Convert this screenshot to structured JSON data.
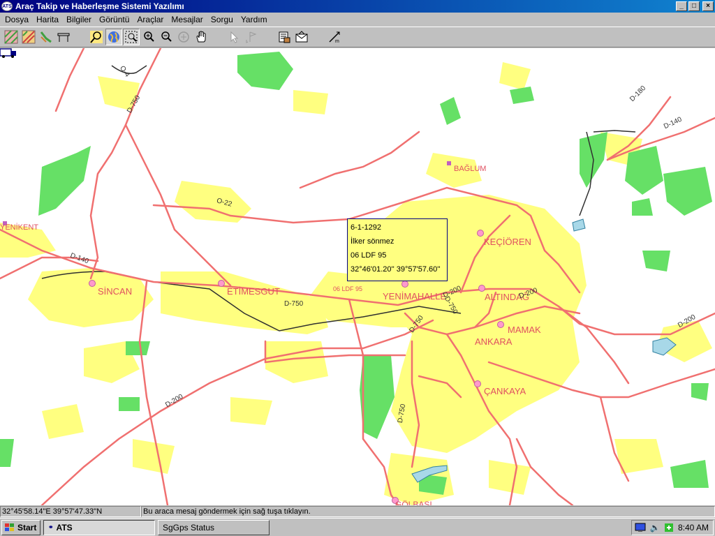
{
  "window": {
    "app_icon": "ATS",
    "title": "Araç Takip ve Haberleşme Sistemi Yazılımı",
    "buttons": [
      "minimize-icon",
      "maximize-icon",
      "close-icon"
    ]
  },
  "menu": [
    "Dosya",
    "Harita",
    "Bilgiler",
    "Görüntü",
    "Araçlar",
    "Mesajlar",
    "Sorgu",
    "Yardım"
  ],
  "toolbar": {
    "icons": [
      "map-layer-icon",
      "map-road-icon",
      "map-route-icon",
      "table-icon",
      "find-vehicle-icon",
      "globe-icon",
      "zoom-window-icon",
      "zoom-in-icon",
      "zoom-out-icon",
      "refresh-map-icon",
      "pan-hand-icon",
      "select-arrow-icon",
      "flag-arrow-icon",
      "vehicle-info-icon",
      "message-envelope-icon",
      "measure-icon"
    ]
  },
  "map": {
    "places": [
      "BAĞLUM",
      "KEÇİÖREN",
      "YENİKENT",
      "SİNCAN",
      "ETİMESGUT",
      "YENİMAHALLE",
      "ALTINDAĞ",
      "MAMAK",
      "ANKARA",
      "ÇANKAYA",
      "GÖLBAŞI"
    ],
    "roads": [
      "D-750",
      "O-4",
      "D-180",
      "D-140",
      "O-22",
      "D-140",
      "D-750",
      "D-200",
      "D-750",
      "D-750",
      "D-200",
      "D-200",
      "D-200",
      "D-750"
    ],
    "colors": {
      "urban": "#ffff80",
      "forest": "#66e066",
      "road": "#f07070",
      "water": "#a8d8e8",
      "place": "#e05060",
      "rail": "#303030"
    }
  },
  "vehicle": {
    "map_label": "06 LDF 95",
    "popup": {
      "line1": "6-1-1292",
      "line2": "İlker sönmez",
      "line3": "06 LDF 95",
      "line4": "32°46'01.20''   39°57'57.60''"
    }
  },
  "status": {
    "coords": "32°45'58.14\"E 39°57'47.33\"N",
    "message": "Bu araca mesaj göndermek için sağ tuşa tıklayın."
  },
  "taskbar": {
    "start": "Start",
    "tasks": [
      "ATS",
      "SgGps Status"
    ],
    "clock": "8:40 AM"
  }
}
